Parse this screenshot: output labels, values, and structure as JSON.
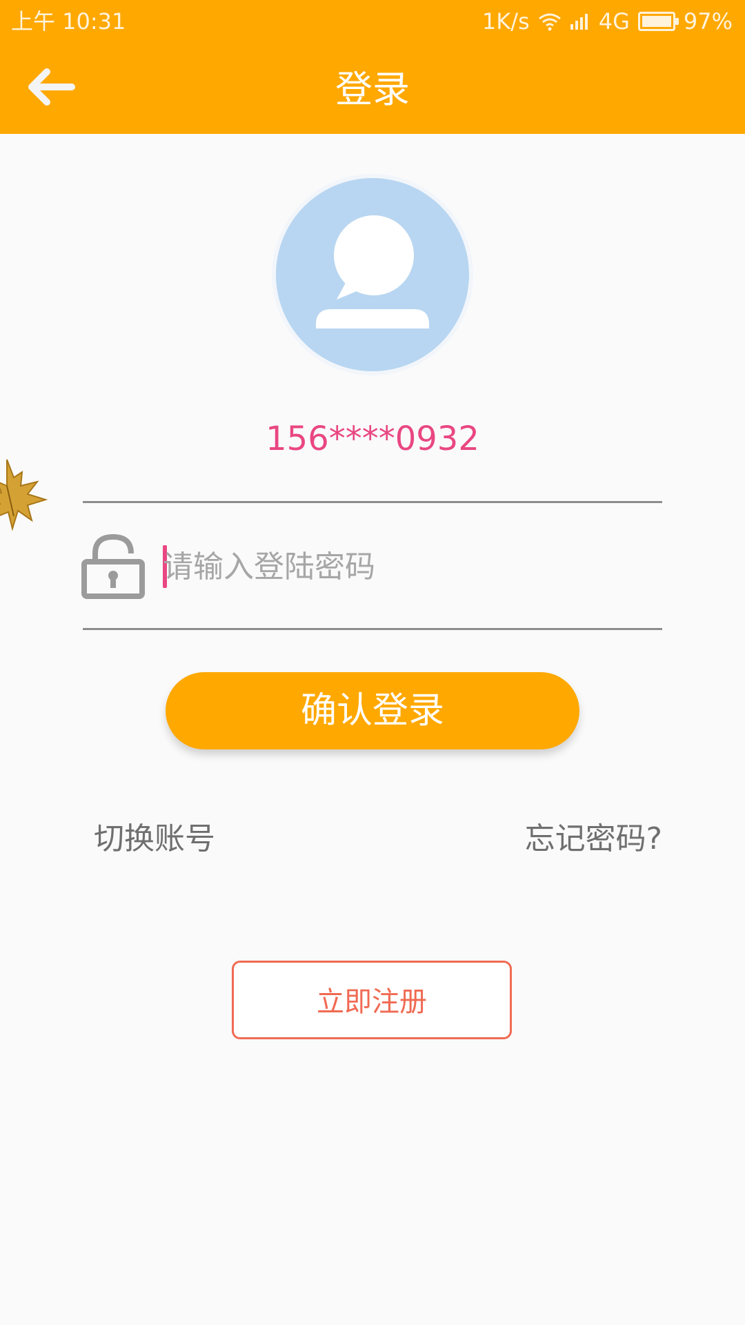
{
  "status_bar": {
    "time": "上午 10:31",
    "network_speed": "1K/s",
    "network_type": "4G",
    "battery_percent": "97%"
  },
  "app_bar": {
    "title": "登录"
  },
  "account": {
    "phone_masked": "156****0932"
  },
  "password_field": {
    "placeholder": "请输入登陆密码",
    "value": ""
  },
  "buttons": {
    "login_label": "确认登录",
    "register_label": "立即注册"
  },
  "links": {
    "switch_account": "切换账号",
    "forgot_password": "忘记密码?"
  },
  "colors": {
    "brand_orange": "#FFA800",
    "accent_pink": "#E94782",
    "avatar_blue": "#B8D6F1",
    "register_red": "#F06A52"
  },
  "icons": {
    "back": "back-arrow-icon",
    "avatar": "user-avatar-icon",
    "lock": "lock-icon",
    "leaf": "maple-leaf-icon",
    "wifi": "wifi-icon",
    "signal": "signal-icon",
    "battery": "battery-icon"
  }
}
